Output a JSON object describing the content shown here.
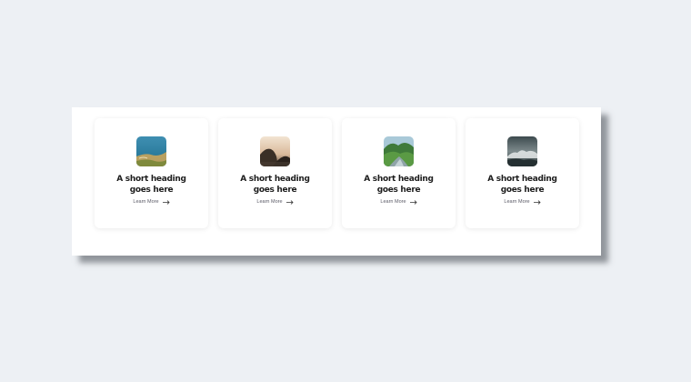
{
  "cards": [
    {
      "image": "coastal-cliff-photo",
      "heading": "A short heading goes here",
      "link_label": "Learn More",
      "link_icon": "arrow-right-icon"
    },
    {
      "image": "sunset-cliffs-photo",
      "heading": "A short heading goes here",
      "link_label": "Learn More",
      "link_icon": "arrow-right-icon"
    },
    {
      "image": "green-valley-river-photo",
      "heading": "A short heading goes here",
      "link_label": "Learn More",
      "link_icon": "arrow-right-icon"
    },
    {
      "image": "foggy-mountain-photo",
      "heading": "A short heading goes here",
      "link_label": "Learn More",
      "link_icon": "arrow-right-icon"
    }
  ],
  "colors": {
    "page_background": "#edf0f4",
    "panel_background": "#ffffff",
    "heading_text": "#1c1c1c",
    "link_text": "#5a5a66"
  }
}
